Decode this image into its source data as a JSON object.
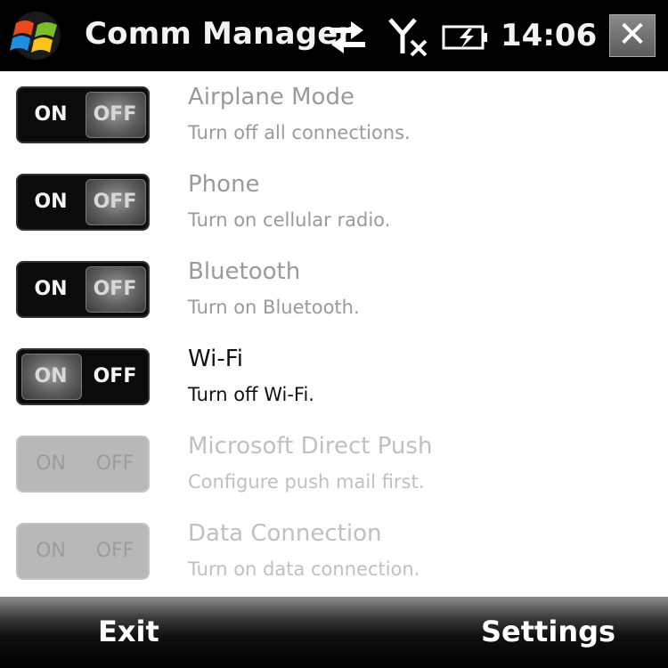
{
  "titlebar": {
    "title": "Comm Manager",
    "time": "14:06",
    "icons": [
      "windows-start-icon",
      "sync-arrows-icon",
      "no-signal-icon",
      "battery-charging-icon",
      "close-icon"
    ],
    "close_label": "✕"
  },
  "toggle_labels": {
    "on": "ON",
    "off": "OFF"
  },
  "items": [
    {
      "name": "Airplane Mode",
      "desc": "Turn off all connections.",
      "state": "off",
      "enabled": true
    },
    {
      "name": "Phone",
      "desc": "Turn on cellular radio.",
      "state": "off",
      "enabled": true
    },
    {
      "name": "Bluetooth",
      "desc": "Turn on Bluetooth.",
      "state": "off",
      "enabled": true
    },
    {
      "name": "Wi-Fi",
      "desc": "Turn off Wi-Fi.",
      "state": "on",
      "enabled": true
    },
    {
      "name": "Microsoft Direct Push",
      "desc": "Configure push mail first.",
      "state": "off",
      "enabled": false
    },
    {
      "name": "Data Connection",
      "desc": "Turn on data connection.",
      "state": "off",
      "enabled": false
    }
  ],
  "softkeys": {
    "left": "Exit",
    "right": "Settings"
  },
  "colors": {
    "titlebar_bg": "#000000",
    "inactive_text": "#9a9a9a",
    "active_text": "#111111",
    "disabled_text": "#c0c0c0"
  }
}
